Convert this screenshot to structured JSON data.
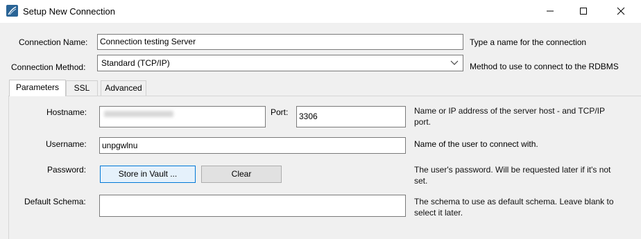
{
  "window": {
    "title": "Setup New Connection",
    "controls": {
      "minimize": "—",
      "maximize": "☐",
      "close": "✕"
    }
  },
  "connection_name": {
    "label": "Connection Name:",
    "value": "Connection testing Server",
    "hint": "Type a name for the connection"
  },
  "connection_method": {
    "label": "Connection Method:",
    "value": "Standard (TCP/IP)",
    "hint": "Method to use to connect to the RDBMS"
  },
  "tabs": [
    {
      "label": "Parameters",
      "active": true
    },
    {
      "label": "SSL",
      "active": false
    },
    {
      "label": "Advanced",
      "active": false
    }
  ],
  "parameters": {
    "hostname": {
      "label": "Hostname:",
      "value": ""
    },
    "port": {
      "label": "Port:",
      "value": "3306"
    },
    "hostname_hint": "Name or IP address of the server host - and TCP/IP port.",
    "username": {
      "label": "Username:",
      "value": "unpgwlnu",
      "hint": "Name of the user to connect with."
    },
    "password": {
      "label": "Password:",
      "store_button": "Store in Vault ...",
      "clear_button": "Clear",
      "hint": "The user's password. Will be requested later if it's not set."
    },
    "default_schema": {
      "label": "Default Schema:",
      "value": "",
      "hint": "The schema to use as default schema. Leave blank to select it later."
    }
  },
  "icons": [
    "app-icon",
    "minimize-icon",
    "maximize-icon",
    "close-icon",
    "chevron-down-icon"
  ]
}
